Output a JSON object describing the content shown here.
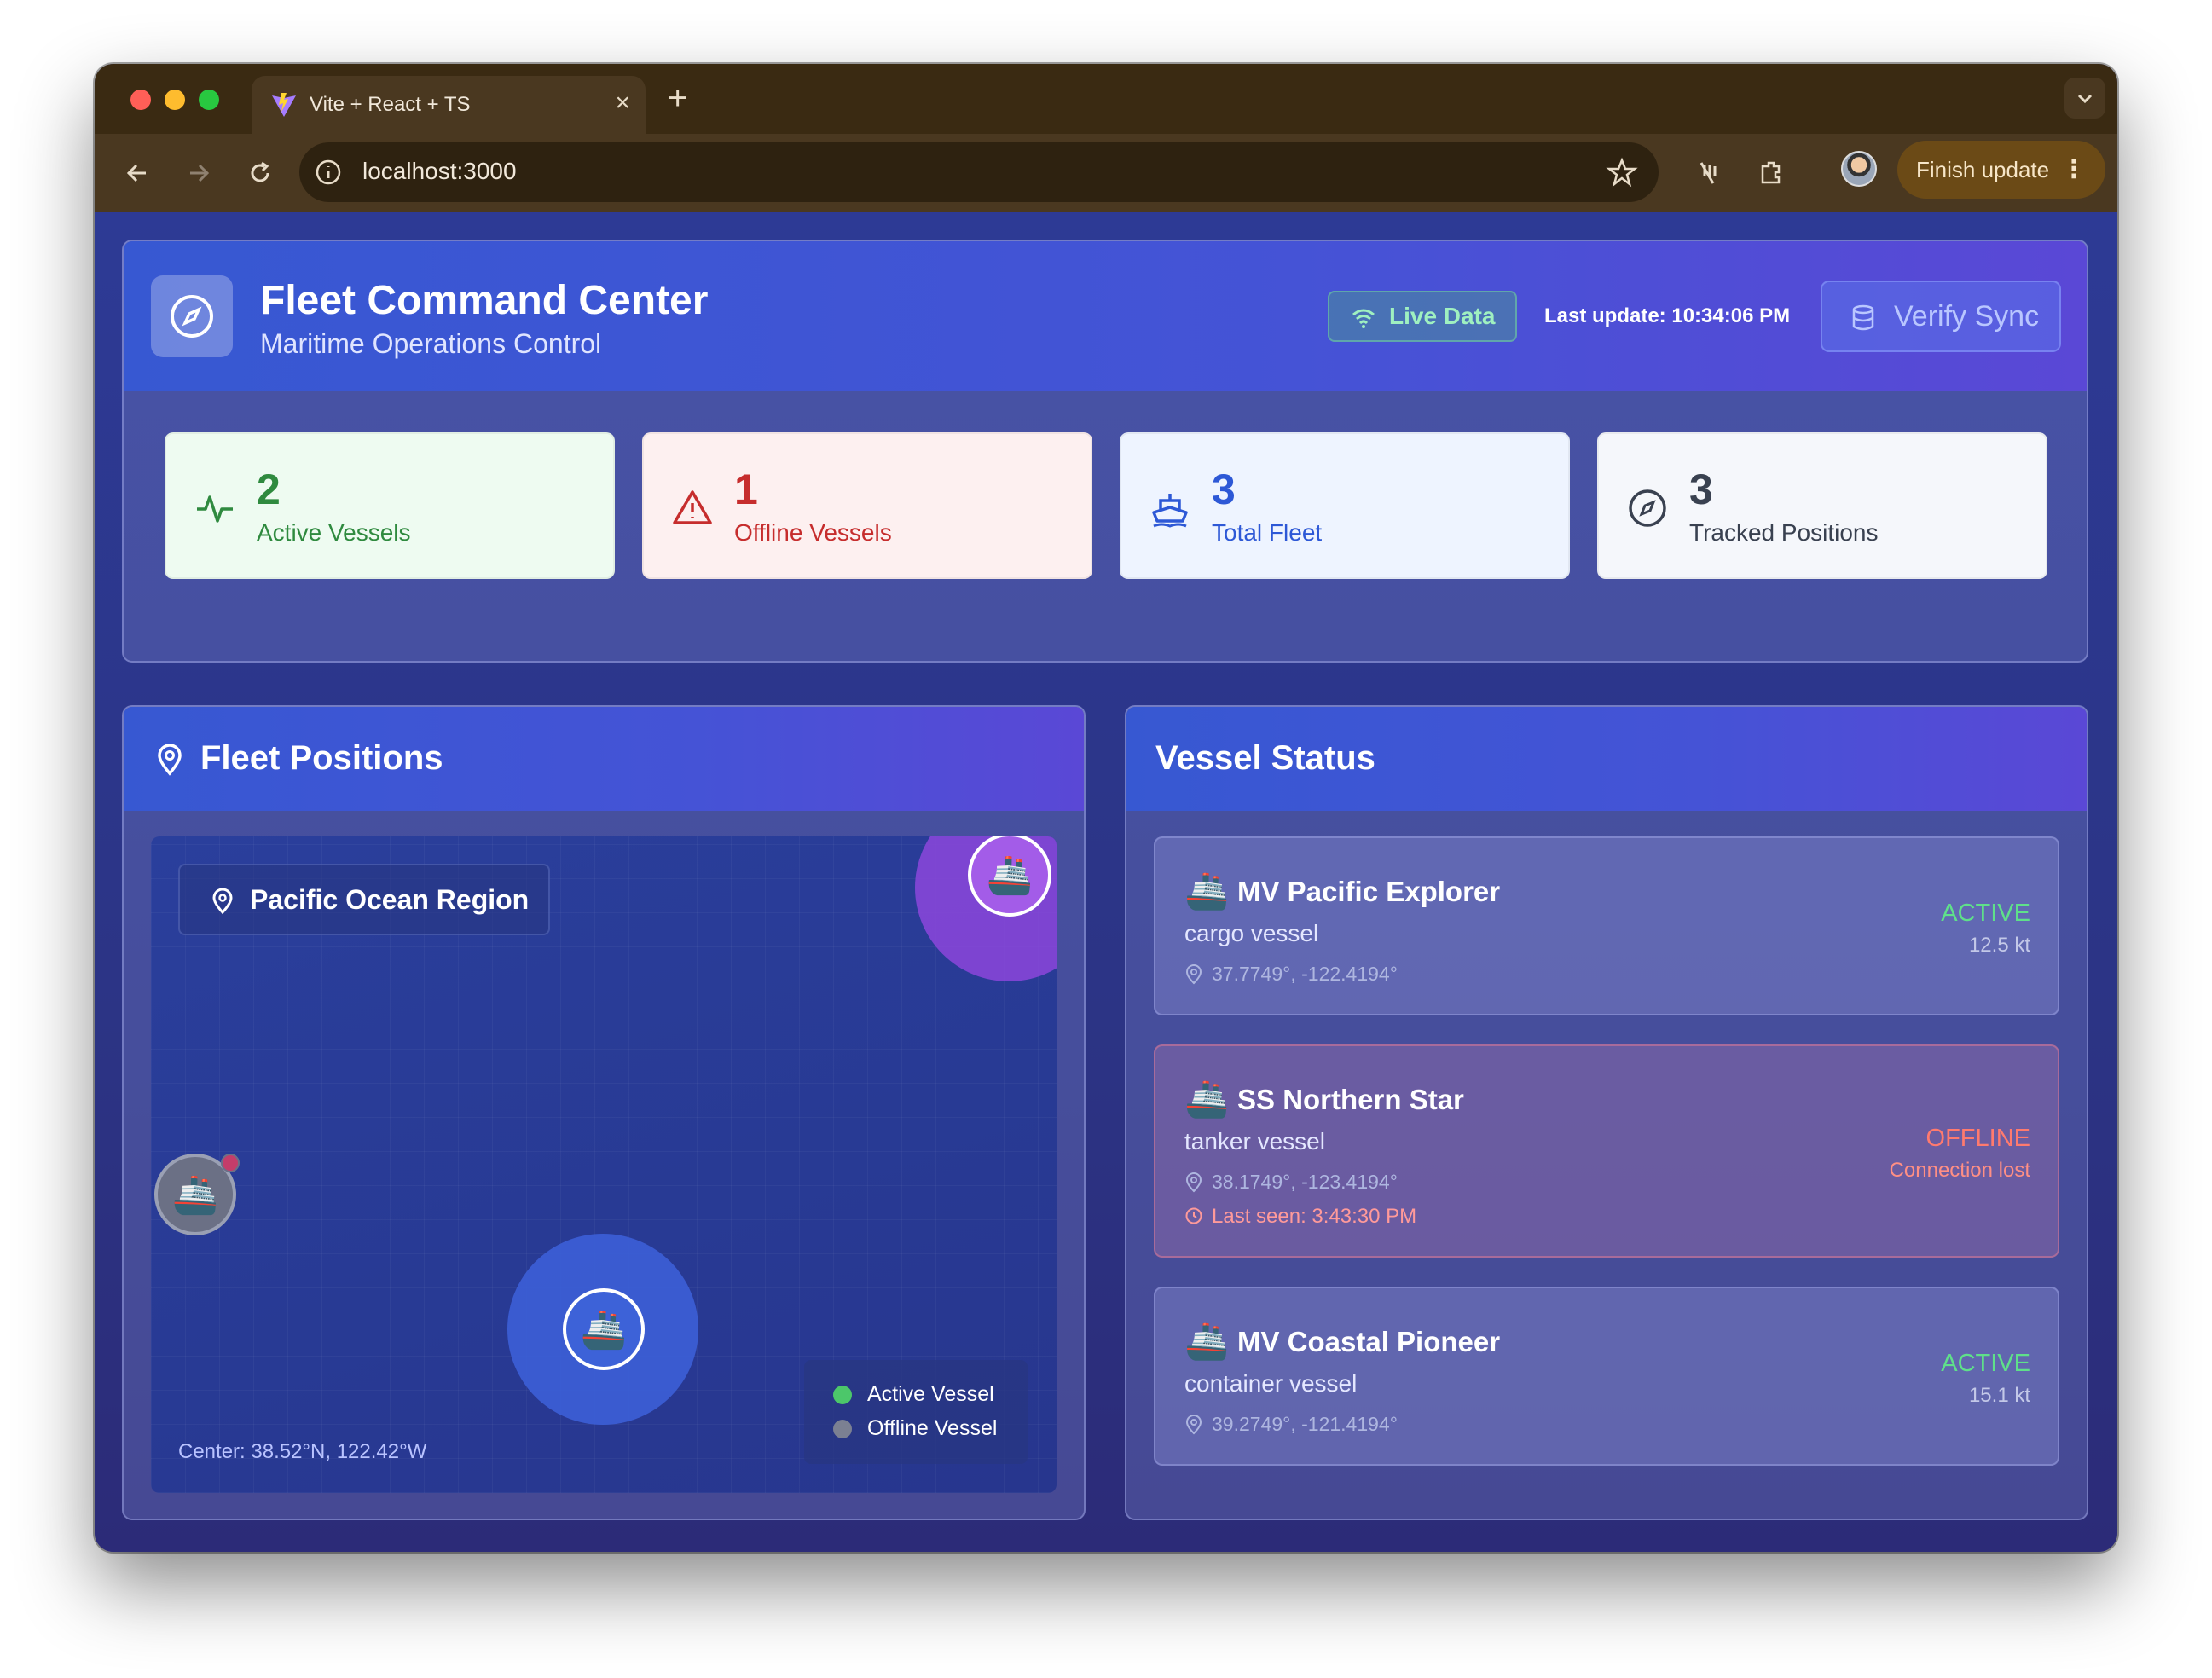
{
  "browser": {
    "tab_title": "Vite + React + TS",
    "tab_close": "×",
    "new_tab": "+",
    "url": "localhost:3000",
    "finish_update": "Finish update",
    "menu_dots": "⋮"
  },
  "header": {
    "title": "Fleet Command Center",
    "subtitle": "Maritime Operations Control",
    "live_badge": "Live Data",
    "last_update": "Last update: 10:34:06 PM",
    "verify_button": "Verify Sync"
  },
  "stats": {
    "active": {
      "value": "2",
      "label": "Active Vessels"
    },
    "offline": {
      "value": "1",
      "label": "Offline Vessels"
    },
    "total": {
      "value": "3",
      "label": "Total Fleet"
    },
    "tracked": {
      "value": "3",
      "label": "Tracked Positions"
    }
  },
  "map": {
    "title": "Fleet Positions",
    "region": "Pacific Ocean Region",
    "legend_active": "Active Vessel",
    "legend_offline": "Offline Vessel",
    "center": "Center: 38.52°N, 122.42°W",
    "ship_glyph": "🚢",
    "colors": {
      "active": "#4cc76a",
      "offline": "#7b8092",
      "accent": "#8a4de0"
    }
  },
  "status": {
    "title": "Vessel Status",
    "vessels": [
      {
        "icon": "🚢",
        "name": "MV Pacific Explorer",
        "type": "cargo vessel",
        "coords": "37.7749°, -122.4194°",
        "status": "ACTIVE",
        "detail": "12.5 kt"
      },
      {
        "icon": "🚢",
        "name": "SS Northern Star",
        "type": "tanker vessel",
        "coords": "38.1749°, -123.4194°",
        "last_seen": "Last seen: 3:43:30 PM",
        "status": "OFFLINE",
        "detail": "Connection lost"
      },
      {
        "icon": "🚢",
        "name": "MV Coastal Pioneer",
        "type": "container vessel",
        "coords": "39.2749°, -121.4194°",
        "status": "ACTIVE",
        "detail": "15.1 kt"
      }
    ]
  }
}
